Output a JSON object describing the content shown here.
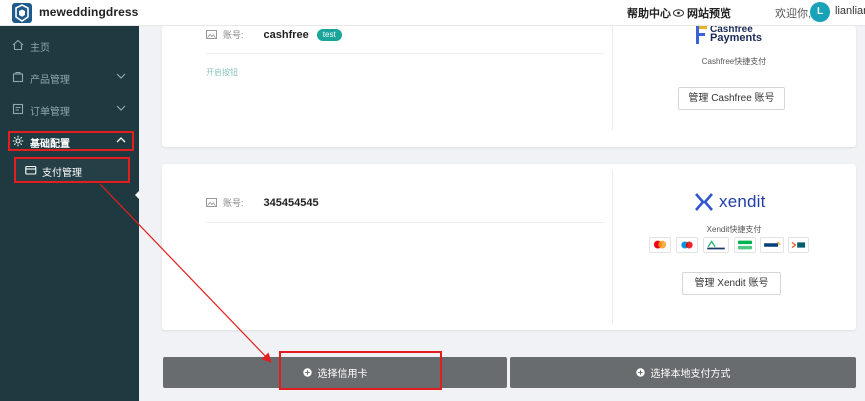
{
  "header": {
    "brand": "meweddingdress",
    "help": "帮助中心",
    "preview": "网站预览",
    "welcome": "欢迎你,",
    "avatar_letter": "L",
    "username": "lianlian"
  },
  "sidebar": {
    "items": [
      {
        "label": "主页",
        "icon": "home-icon"
      },
      {
        "label": "产品管理",
        "icon": "product-icon"
      },
      {
        "label": "订单管理",
        "icon": "order-icon"
      },
      {
        "label": "基础配置",
        "icon": "gear-icon"
      }
    ],
    "sub_item": {
      "label": "支付管理",
      "icon": "payment-card-icon"
    }
  },
  "cards": {
    "cashfree": {
      "account_label": "账号:",
      "account_value": "cashfree",
      "tag": "test",
      "faint_link": "开启按钮",
      "logo_top": "Cashfree",
      "logo_bottom": "Payments",
      "desc": "Cashfree快捷支付",
      "manage_label": "管理 Cashfree 账号"
    },
    "xendit": {
      "account_label": "账号:",
      "account_value": "345454545",
      "logo_text": "xendit",
      "desc": "Xendit快捷支付",
      "manage_label": "管理 Xendit 账号",
      "payment_logos": [
        "mastercard",
        "maestro",
        "PayMaya",
        "Grab Pay",
        "mandiri",
        "BNI"
      ]
    }
  },
  "buttons": {
    "credit_card": "选择信用卡",
    "local_payment": "选择本地支付方式"
  },
  "colors": {
    "sidebar_bg": "#1e3a40",
    "accent": "#17a2b8",
    "annotation": "#e21e1e",
    "bottom_button": "#696c6e"
  }
}
